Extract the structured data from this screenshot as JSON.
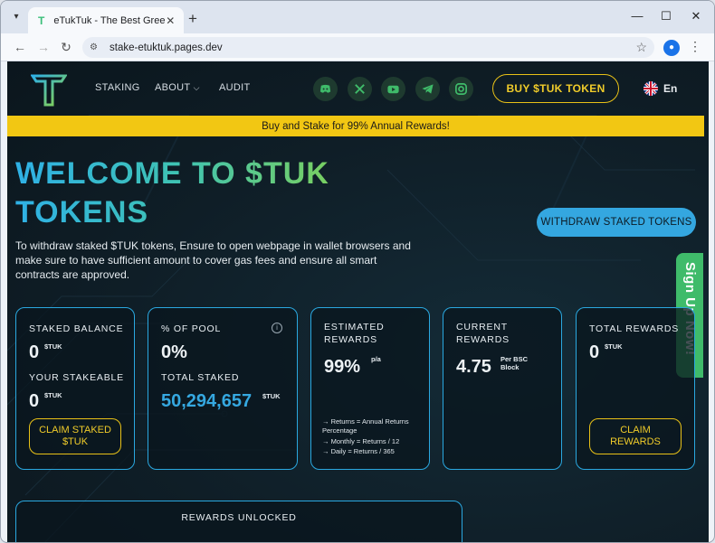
{
  "browser": {
    "tab_title": "eTukTuk - The Best Green Crypto",
    "url": "stake-etuktuk.pages.dev"
  },
  "nav": {
    "links": [
      "STAKING",
      "ABOUT",
      "AUDIT"
    ],
    "buy_label": "BUY $TUK TOKEN",
    "lang": "En",
    "social_icons": [
      "discord-icon",
      "x-icon",
      "youtube-icon",
      "telegram-icon",
      "instagram-icon"
    ]
  },
  "banner": "Buy and Stake for 99% Annual Rewards!",
  "hero": {
    "title_line1": "WELCOME TO $TUK",
    "title_line2": "TOKENS",
    "text": "To withdraw staked $TUK tokens, Ensure to open webpage in wallet browsers and make sure to have sufficient amount to cover gas fees and ensure all smart contracts are approved.",
    "withdraw_label": "WITHDRAW STAKED TOKENS"
  },
  "signup": "Sign Up Now!",
  "cards": {
    "staked": {
      "label": "STAKED BALANCE",
      "value": "0",
      "unit": "$TUK",
      "label2": "YOUR STAKEABLE",
      "value2": "0",
      "unit2": "$TUK",
      "claim": "CLAIM STAKED $TUK"
    },
    "pool": {
      "label": "% OF POOL",
      "value": "0%",
      "label2": "TOTAL STAKED",
      "value2": "50,294,657",
      "unit2": "$TUK"
    },
    "estimated": {
      "label": "ESTIMATED REWARDS",
      "value": "99%",
      "unit": "p/a",
      "notes": [
        "→ Returns = Annual Returns Percentage",
        "→ Monthly = Returns / 12",
        "→ Daily = Returns / 365"
      ]
    },
    "current": {
      "label": "CURRENT REWARDS",
      "value": "4.75",
      "unit": "Per BSC Block"
    },
    "total": {
      "label": "TOTAL REWARDS",
      "value": "0",
      "unit": "$TUK",
      "claim": "CLAIM REWARDS"
    }
  },
  "unlock_label": "REWARDS UNLOCKED",
  "colors": {
    "accent_blue": "#2aa8e0",
    "gold": "#f2c713",
    "green": "#3fbb6a"
  }
}
